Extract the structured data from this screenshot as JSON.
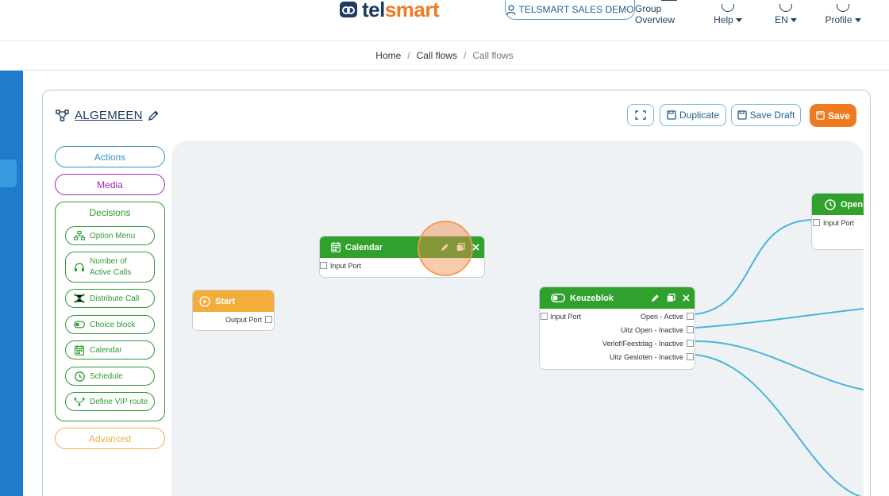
{
  "header": {
    "logo_prefix": "tel",
    "logo_suffix": "smart",
    "demo_label": "TELSMART SALES DEMO",
    "nav": {
      "group_overview": "Group Overview",
      "help": "Help",
      "language": "EN",
      "profile": "Profile"
    }
  },
  "breadcrumb": [
    "Home",
    "Call flows",
    "Call flows"
  ],
  "flow": {
    "title": "ALGEMEEN"
  },
  "toolbar": {
    "duplicate": "Duplicate",
    "save_draft": "Save Draft",
    "save": "Save"
  },
  "sidebar": {
    "actions": "Actions",
    "media": "Media",
    "decisions_title": "Decisions",
    "decisions": [
      {
        "label": "Option Menu",
        "icon": "sitemap-icon"
      },
      {
        "label": "Number of Active Calls",
        "icon": "headset-icon"
      },
      {
        "label": "Distribute Call",
        "icon": "share-nodes-icon"
      },
      {
        "label": "Choice block",
        "icon": "toggle-icon"
      },
      {
        "label": "Calendar",
        "icon": "calendar-icon"
      },
      {
        "label": "Schedule",
        "icon": "clock-icon"
      },
      {
        "label": "Define VIP route",
        "icon": "route-icon"
      }
    ],
    "advanced": "Advanced"
  },
  "nodes": {
    "start": {
      "title": "Start",
      "ports": [
        "Output Port"
      ]
    },
    "calendar": {
      "title": "Calendar",
      "ports": [
        "Input Port"
      ]
    },
    "keuzeblok": {
      "title": "Keuzeblok",
      "input": "Input Port",
      "outputs": [
        "Open - Active",
        "Uitz Open - Inactive",
        "Verlof/Feestdag - Inactive",
        "Uitz Gesloten - Inactive"
      ]
    },
    "open": {
      "title": "Open",
      "ports": [
        "Input Port"
      ]
    }
  },
  "colors": {
    "brand_dark": "#1d3b5f",
    "accent_orange": "#f07a22",
    "decision_green": "#2e9a34",
    "actions_blue": "#2a90c9",
    "media_purple": "#9b2ab8",
    "advanced_yellow": "#e6b24a",
    "wire_blue": "#4ab4d8"
  }
}
